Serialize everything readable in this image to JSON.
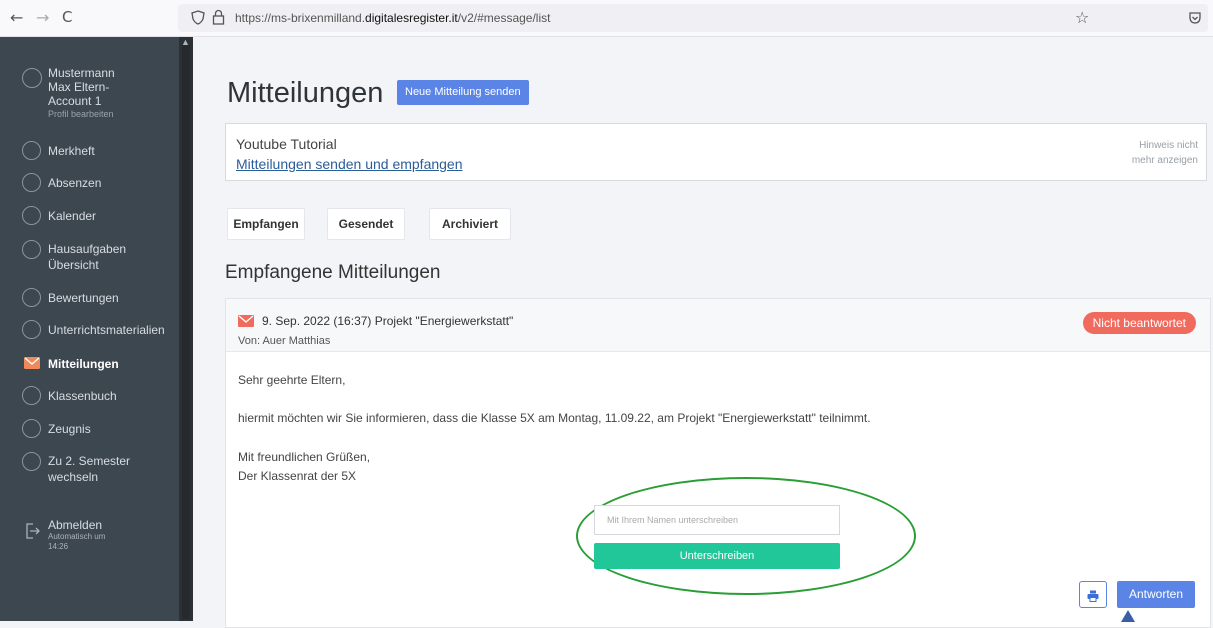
{
  "browser": {
    "back_icon": "←",
    "forward_icon": "→",
    "reload_icon": "C",
    "url_prefix": "https://ms-brixenmilland.",
    "url_domain": "digitalesregister.it",
    "url_suffix": "/v2/#message/list",
    "star_icon": "☆",
    "pocket_icon": "♡"
  },
  "sidebar": {
    "profile": {
      "name_line1": "Mustermann",
      "name_line2": "Max Eltern-",
      "name_line3": "Account 1",
      "edit_label": "Profil bearbeiten"
    },
    "items": [
      {
        "label": "Merkheft"
      },
      {
        "label": "Absenzen"
      },
      {
        "label": "Kalender"
      },
      {
        "label_line1": "Hausaufgaben",
        "label_line2": "Übersicht"
      },
      {
        "label": "Bewertungen"
      },
      {
        "label": "Unterrichtsmaterialien"
      },
      {
        "label": "Mitteilungen"
      },
      {
        "label": "Klassenbuch"
      },
      {
        "label": "Zeugnis"
      },
      {
        "label_line1": "Zu 2. Semester",
        "label_line2": "wechseln"
      }
    ],
    "logout": {
      "label": "Abmelden",
      "sub_line1": "Automatisch um",
      "sub_line2": "14:26"
    }
  },
  "page": {
    "title": "Mitteilungen",
    "new_message_button": "Neue Mitteilung senden"
  },
  "tutorial": {
    "title": "Youtube Tutorial",
    "link": "Mitteilungen senden und empfangen",
    "hide_line1": "Hinweis nicht",
    "hide_line2": "mehr anzeigen"
  },
  "tabs": [
    {
      "label": "Empfangen"
    },
    {
      "label": "Gesendet"
    },
    {
      "label": "Archiviert"
    }
  ],
  "section_title": "Empfangene Mitteilungen",
  "message": {
    "date_subject": "9. Sep. 2022 (16:37)  Projekt \"Energiewerkstatt\"",
    "from": "Von: Auer Matthias",
    "status_badge": "Nicht beantwortet",
    "status_color": "#f16a5e",
    "body_greeting": "Sehr geehrte Eltern,",
    "body_text": "hiermit möchten wir Sie informieren, dass die Klasse 5X am Montag, 11.09.22, am Projekt \"Energiewerkstatt\" teilnimmt.",
    "body_closing": "Mit freundlichen Grüßen,",
    "body_signature": "Der Klassenrat der 5X",
    "sign_placeholder": "Mit Ihrem Namen unterschreiben",
    "sign_button": "Unterschreiben",
    "reply_button": "Antworten"
  },
  "colors": {
    "accent": "#5a84e6",
    "sign_green": "#21c799",
    "sidebar_bg": "#3d4750",
    "active_icon": "#f08a5d"
  }
}
